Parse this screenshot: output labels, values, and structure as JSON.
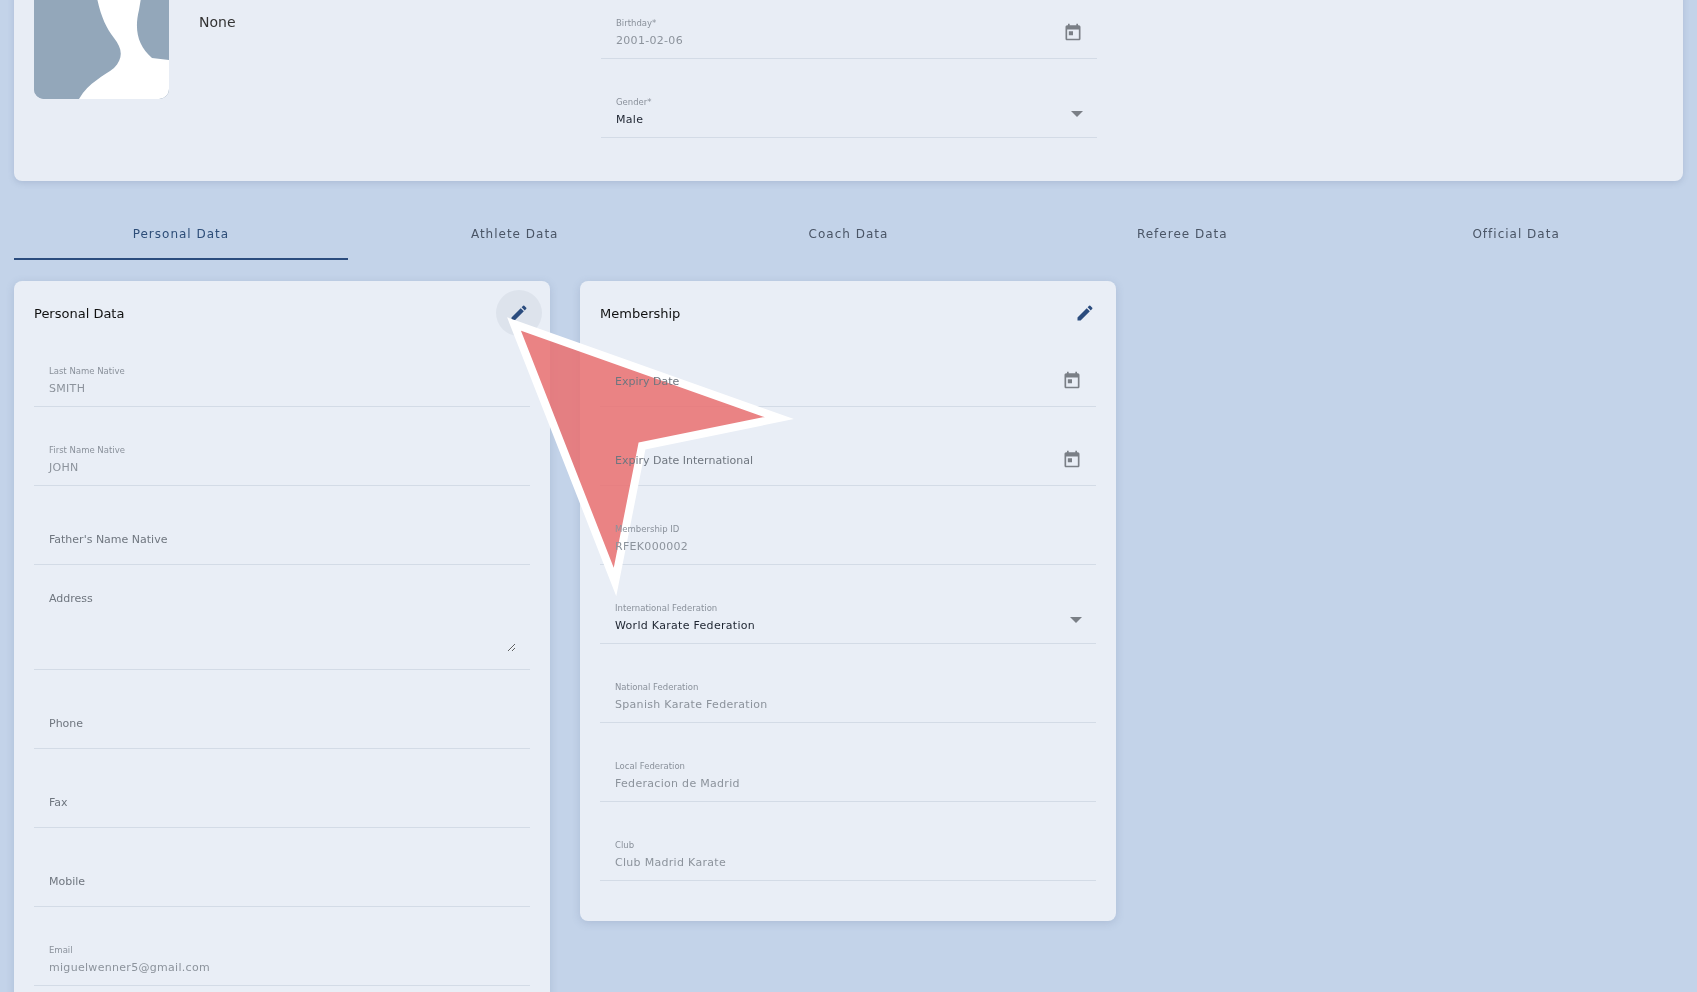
{
  "profile": {
    "name": "None",
    "fields": [
      {
        "kind": "date",
        "label": "Birthday*",
        "value": "2001-02-06",
        "disabled": true
      },
      {
        "kind": "select",
        "label": "Gender*",
        "value": "Male",
        "disabled": false
      }
    ]
  },
  "tabs": [
    {
      "label": "Personal Data",
      "selected": true
    },
    {
      "label": "Athlete Data",
      "selected": false
    },
    {
      "label": "Coach Data",
      "selected": false
    },
    {
      "label": "Referee Data",
      "selected": false
    },
    {
      "label": "Official Data",
      "selected": false
    }
  ],
  "cards": [
    {
      "title": "Personal Data",
      "edit_hovered": true,
      "fields": [
        {
          "kind": "text",
          "label": "Last Name Native",
          "value": "SMITH",
          "disabled": true
        },
        {
          "kind": "text",
          "label": "First Name Native",
          "value": "JOHN",
          "disabled": true
        },
        {
          "kind": "text",
          "placeholder": "Father's Name Native"
        },
        {
          "kind": "textarea",
          "placeholder": "Address"
        },
        {
          "kind": "text",
          "placeholder": "Phone"
        },
        {
          "kind": "text",
          "placeholder": "Fax"
        },
        {
          "kind": "text",
          "placeholder": "Mobile"
        },
        {
          "kind": "text",
          "label": "Email",
          "value": "miguelwenner5@gmail.com",
          "disabled": true
        }
      ]
    },
    {
      "title": "Membership",
      "edit_hovered": false,
      "fields": [
        {
          "kind": "date",
          "placeholder": "Expiry Date"
        },
        {
          "kind": "date",
          "placeholder": "Expiry Date International"
        },
        {
          "kind": "text",
          "label": "Membership ID",
          "value": "RFEK000002",
          "disabled": true
        },
        {
          "kind": "select",
          "label": "International Federation",
          "value": "World Karate Federation",
          "disabled": false
        },
        {
          "kind": "text",
          "label": "National Federation",
          "value": "Spanish Karate Federation",
          "disabled": true
        },
        {
          "kind": "text",
          "label": "Local Federation",
          "value": "Federacion de Madrid",
          "disabled": true
        },
        {
          "kind": "text",
          "label": "Club",
          "value": "Club Madrid Karate",
          "disabled": true
        }
      ]
    }
  ]
}
